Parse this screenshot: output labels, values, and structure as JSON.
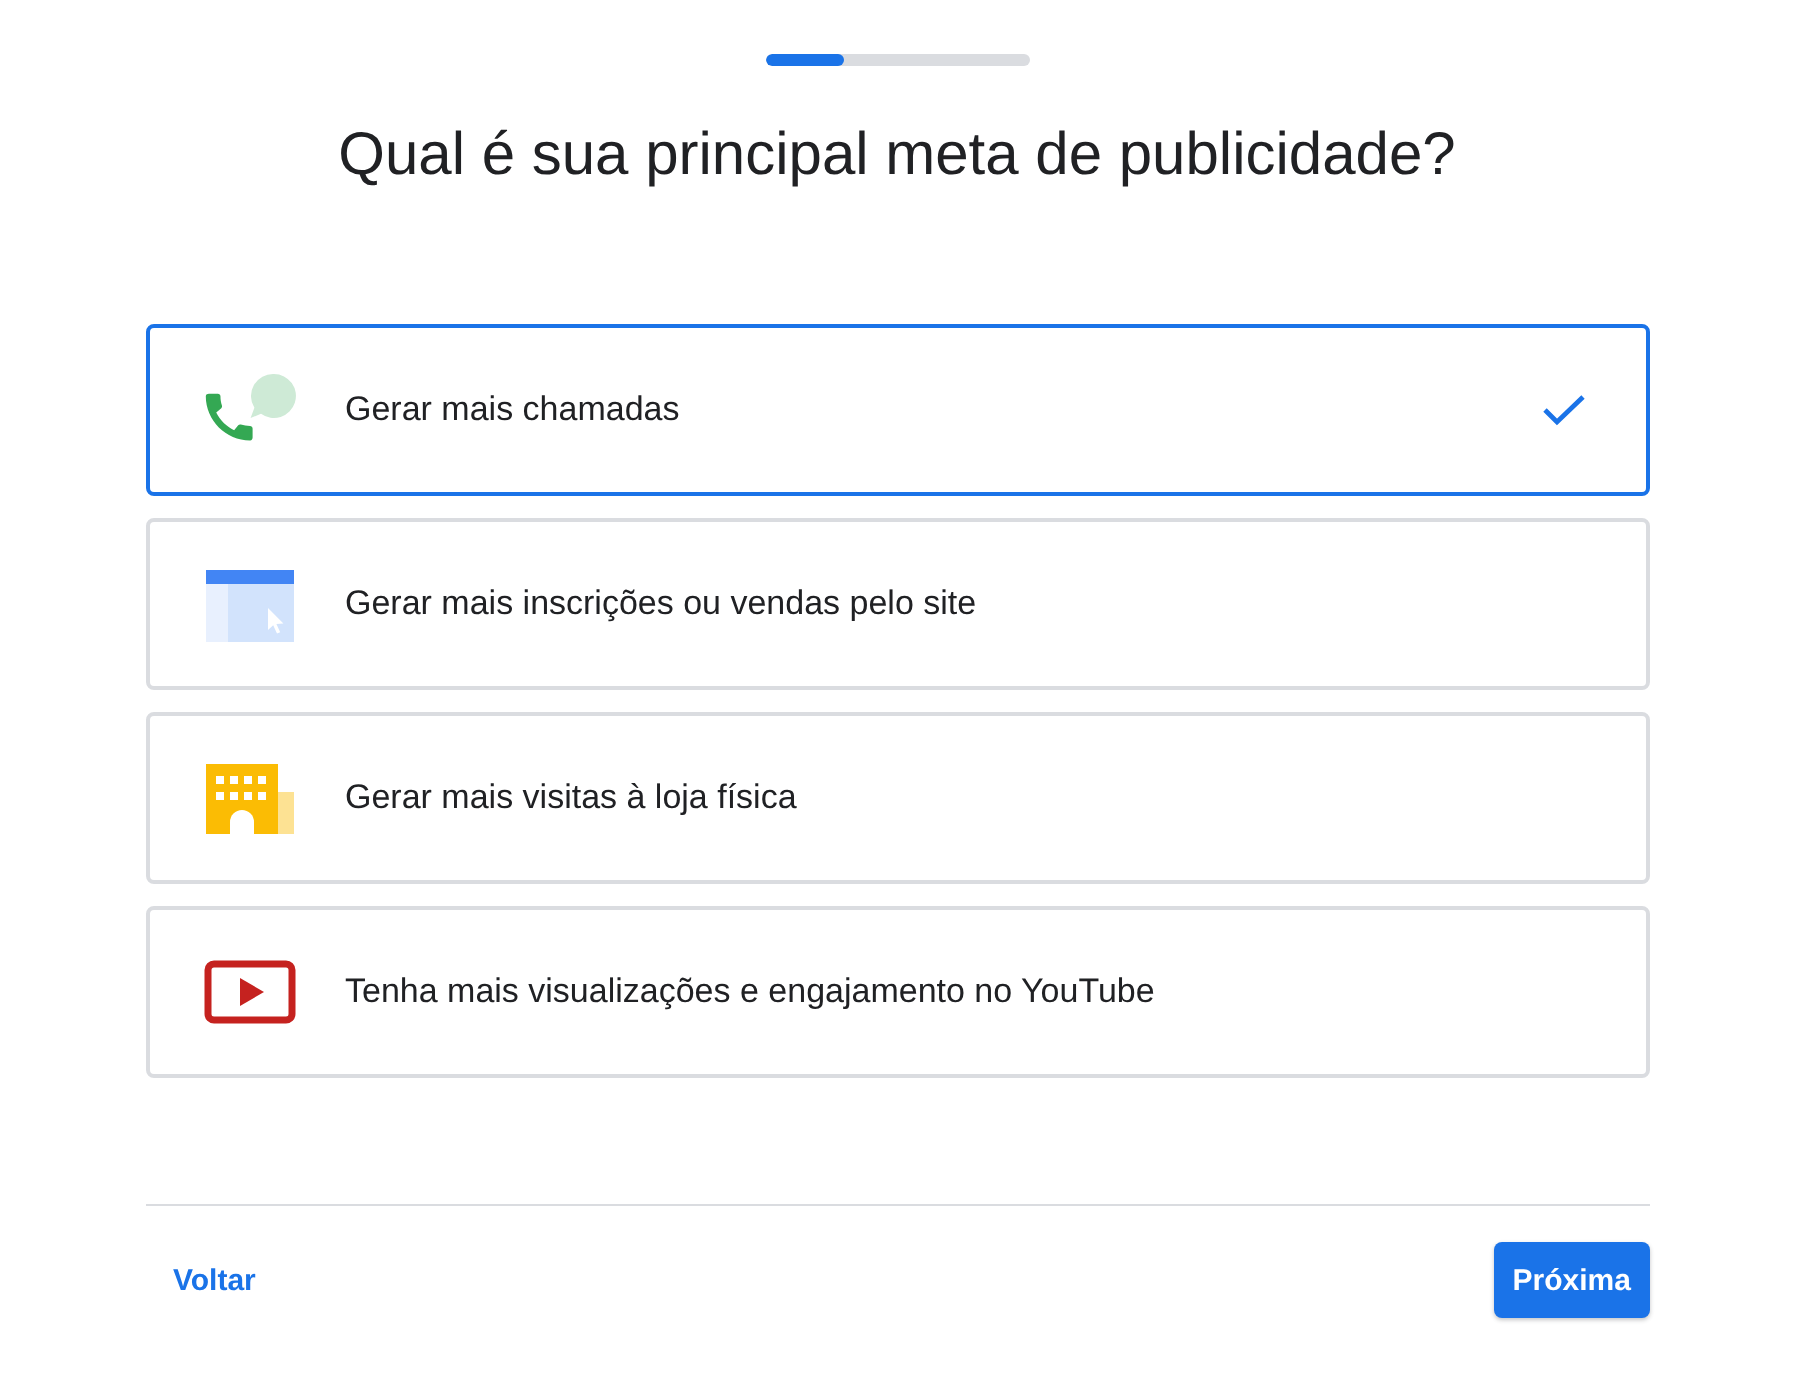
{
  "progress": {
    "level": 0.3
  },
  "title": "Qual é sua principal meta de publicidade?",
  "options": [
    {
      "kind": "phone",
      "label": "Gerar mais chamadas",
      "selected": true
    },
    {
      "kind": "web",
      "label": "Gerar mais inscrições ou vendas pelo site",
      "selected": false
    },
    {
      "kind": "store",
      "label": "Gerar mais visitas à loja física",
      "selected": false
    },
    {
      "kind": "video",
      "label": "Tenha mais visualizações e engajamento no YouTube",
      "selected": false
    }
  ],
  "footer": {
    "back": "Voltar",
    "next": "Próxima"
  }
}
